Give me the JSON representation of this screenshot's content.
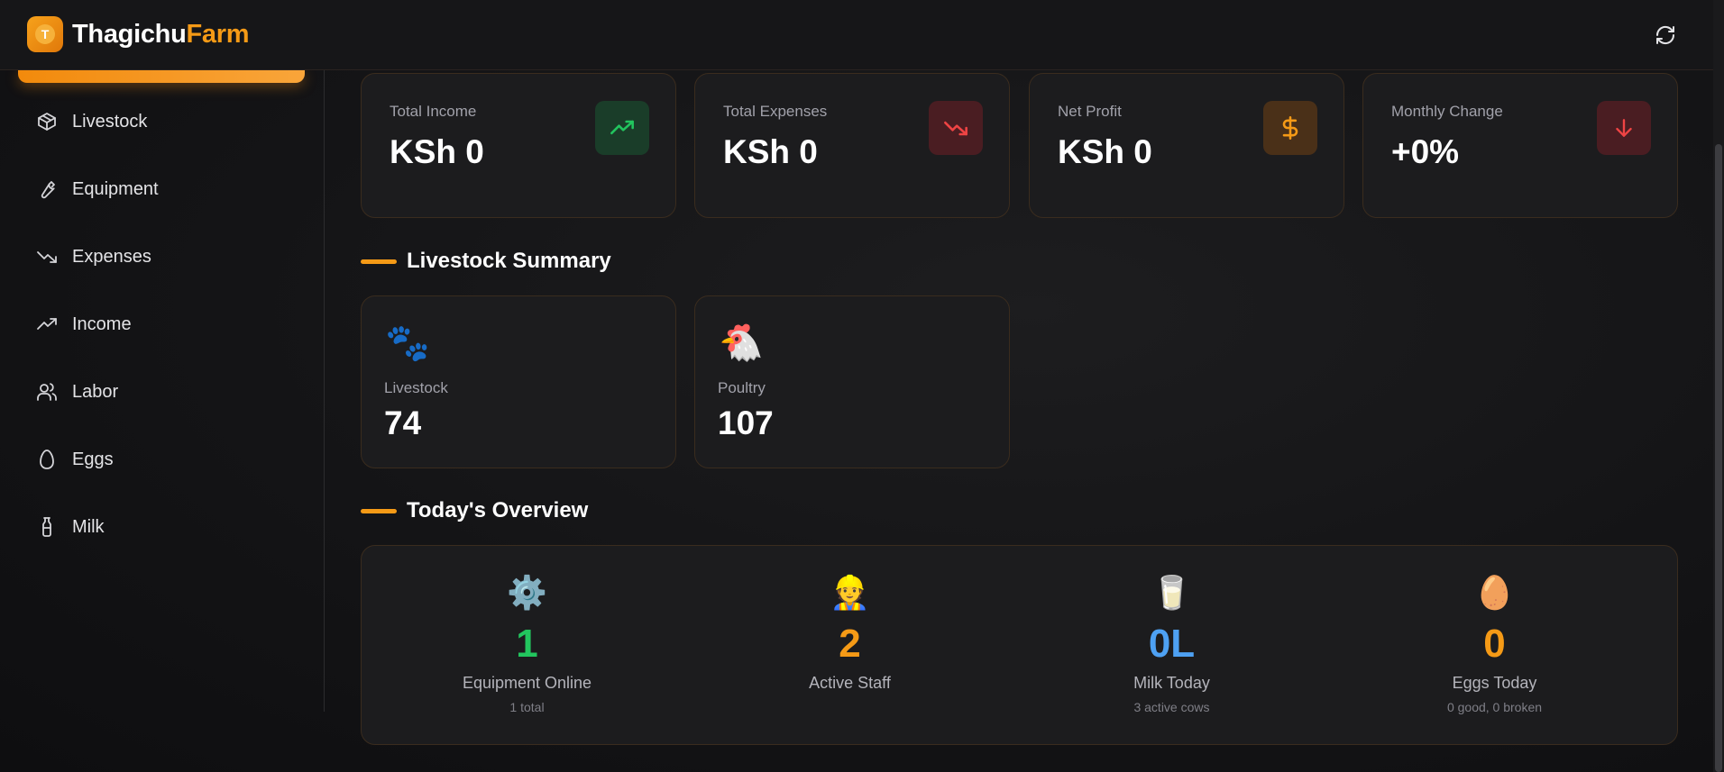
{
  "app": {
    "brand_part1": "Thagichu",
    "brand_part2": "Farm",
    "logo_letter": "T",
    "accent_color": "#f59a16"
  },
  "sidebar": {
    "items": [
      {
        "label": "Livestock",
        "icon": "box-icon"
      },
      {
        "label": "Equipment",
        "icon": "wrench-icon"
      },
      {
        "label": "Expenses",
        "icon": "trending-down-icon"
      },
      {
        "label": "Income",
        "icon": "trending-up-icon"
      },
      {
        "label": "Labor",
        "icon": "users-icon"
      },
      {
        "label": "Eggs",
        "icon": "egg-icon"
      },
      {
        "label": "Milk",
        "icon": "bottle-icon"
      }
    ]
  },
  "stats": [
    {
      "label": "Total Income",
      "value": "KSh 0",
      "icon": "trending-up-icon",
      "color": "#22c55e"
    },
    {
      "label": "Total Expenses",
      "value": "KSh 0",
      "icon": "trending-down-icon",
      "color": "#ef4444"
    },
    {
      "label": "Net Profit",
      "value": "KSh 0",
      "icon": "dollar-icon",
      "color": "#f59a16"
    },
    {
      "label": "Monthly Change",
      "value": "+0%",
      "icon": "arrow-down-icon",
      "color": "#ef4444"
    }
  ],
  "livestock_summary": {
    "title": "Livestock Summary",
    "cards": [
      {
        "emoji": "🐾",
        "label": "Livestock",
        "value": "74"
      },
      {
        "emoji": "🐔",
        "label": "Poultry",
        "value": "107"
      }
    ]
  },
  "overview": {
    "title": "Today's Overview",
    "items": [
      {
        "emoji": "⚙️",
        "value": "1",
        "label": "Equipment Online",
        "sub": "1 total",
        "color": "#22c55e"
      },
      {
        "emoji": "👷",
        "value": "2",
        "label": "Active Staff",
        "sub": "",
        "color": "#f59a16"
      },
      {
        "emoji": "🥛",
        "value": "0L",
        "label": "Milk Today",
        "sub": "3 active cows",
        "color": "#4ea1f3"
      },
      {
        "emoji": "🥚",
        "value": "0",
        "label": "Eggs Today",
        "sub": "0 good, 0 broken",
        "color": "#f59a16"
      }
    ]
  }
}
